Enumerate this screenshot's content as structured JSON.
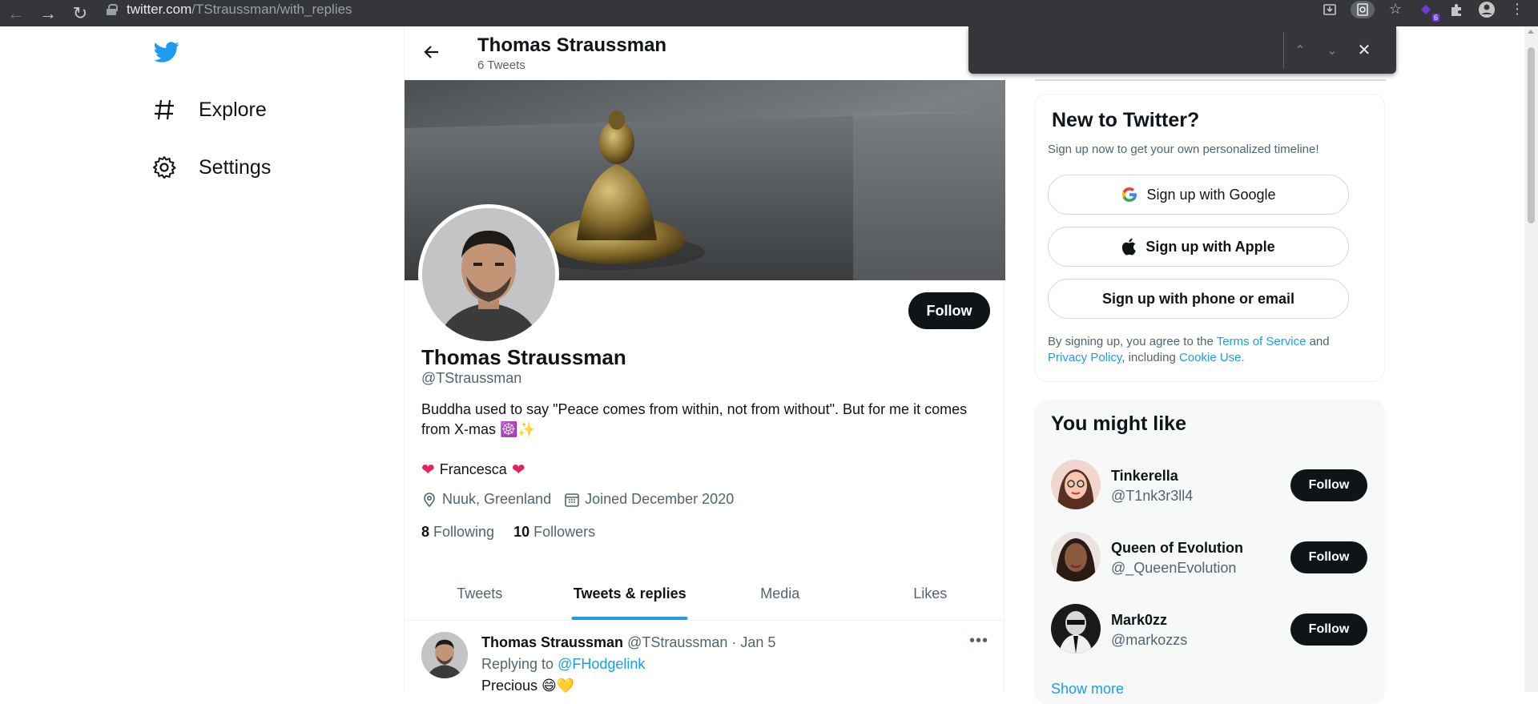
{
  "browser": {
    "url_host": "twitter.com",
    "url_path": "/TStraussman/with_replies",
    "extension_badge": "6"
  },
  "nav": {
    "explore": "Explore",
    "settings": "Settings"
  },
  "header": {
    "name": "Thomas Straussman",
    "count": "6 Tweets"
  },
  "profile": {
    "follow_label": "Follow",
    "name": "Thomas Straussman",
    "handle": "@TStraussman",
    "bio": "Buddha used to say \"Peace comes from within, not from without\". But for me it comes from X-mas ☸️✨",
    "partner": "Francesca",
    "location": "Nuuk, Greenland",
    "joined": "Joined December 2020",
    "following_count": "8",
    "following_label": "Following",
    "followers_count": "10",
    "followers_label": "Followers"
  },
  "tabs": [
    {
      "label": "Tweets",
      "active": false
    },
    {
      "label": "Tweets & replies",
      "active": true
    },
    {
      "label": "Media",
      "active": false
    },
    {
      "label": "Likes",
      "active": false
    }
  ],
  "tweet": {
    "name": "Thomas Straussman",
    "handle": "@TStraussman",
    "date": "· Jan 5",
    "reply_prefix": "Replying to",
    "reply_to": "@FHodgelink",
    "text": "Precious 😄💛"
  },
  "signup": {
    "title": "New to Twitter?",
    "subtitle": "Sign up now to get your own personalized timeline!",
    "google": "Sign up with Google",
    "apple": "Sign up with Apple",
    "phone": "Sign up with phone or email",
    "terms_1": "By signing up, you agree to the",
    "terms_link": "Terms of Service",
    "terms_2": "and",
    "privacy_link": "Privacy Policy",
    "terms_3": ", including",
    "cookie_link": "Cookie Use."
  },
  "suggestions": {
    "title": "You might like",
    "follow_label": "Follow",
    "show_more": "Show more",
    "items": [
      {
        "name": "Tinkerella",
        "handle": "@T1nk3r3ll4"
      },
      {
        "name": "Queen of Evolution",
        "handle": "@_QueenEvolution"
      },
      {
        "name": "Mark0zz",
        "handle": "@markozzs"
      }
    ]
  },
  "colors": {
    "accent": "#1d9bf0",
    "text": "#0f1419",
    "muted": "#536471"
  }
}
